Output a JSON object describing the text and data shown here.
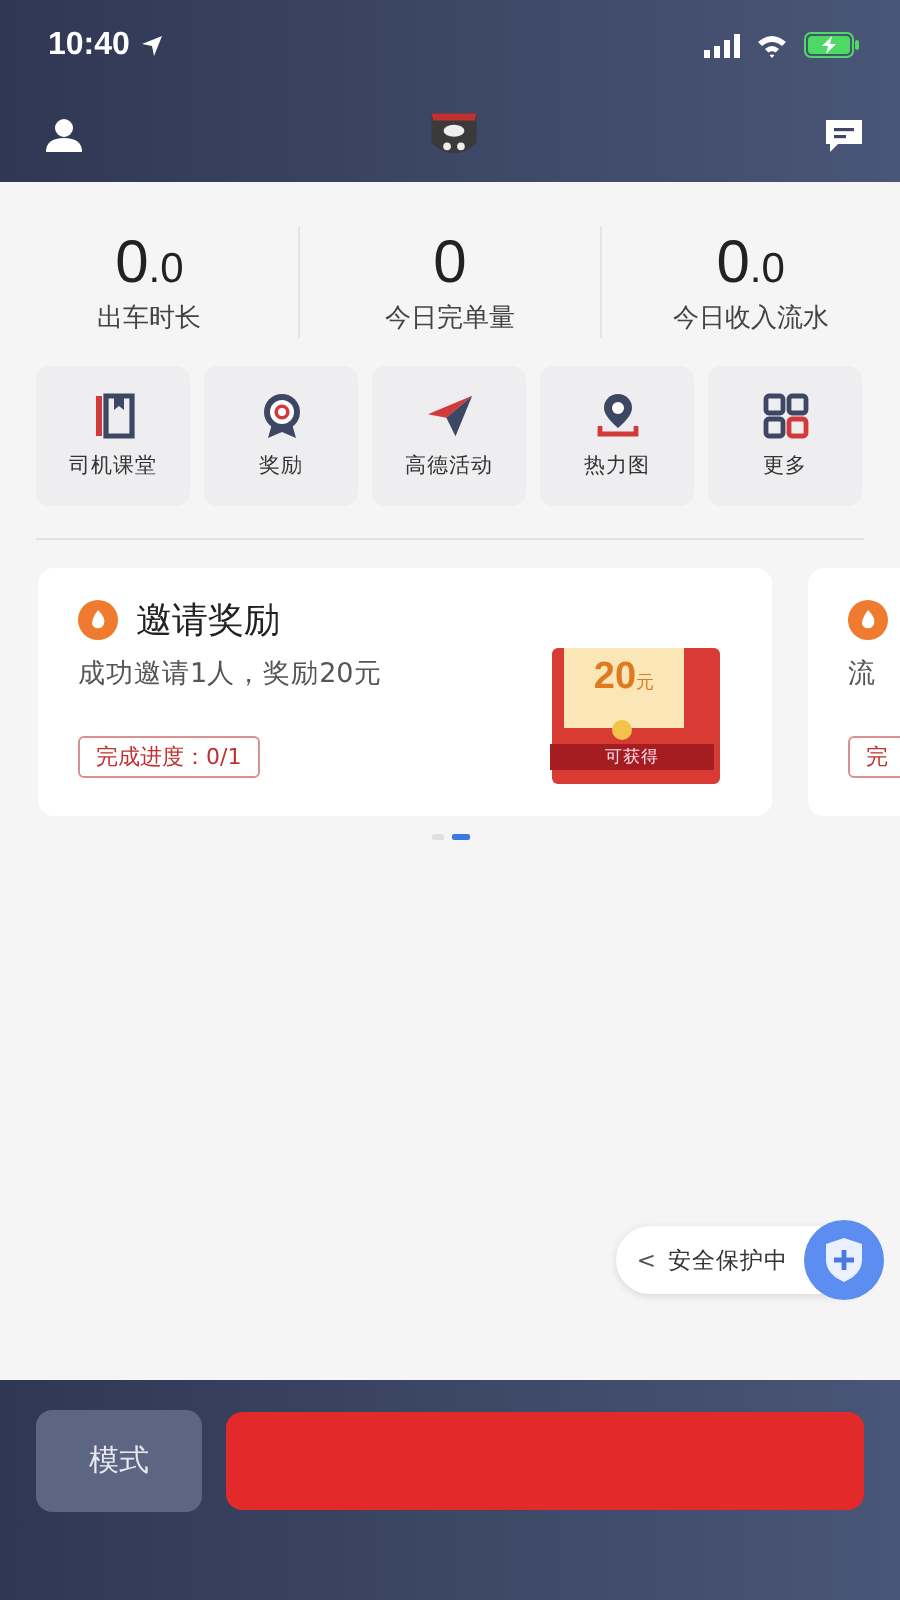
{
  "status_bar": {
    "time": "10:40"
  },
  "stats": [
    {
      "value": "0",
      "decimal": ".0",
      "label": "出车时长"
    },
    {
      "value": "0",
      "label": "今日完单量"
    },
    {
      "value": "0",
      "decimal": ".0",
      "label": "今日收入流水"
    }
  ],
  "shortcuts": [
    {
      "kind": "book",
      "label": "司机课堂"
    },
    {
      "kind": "medal",
      "label": "奖励"
    },
    {
      "kind": "plane",
      "label": "高德活动"
    },
    {
      "kind": "pin",
      "label": "热力图"
    },
    {
      "kind": "grid",
      "label": "更多"
    }
  ],
  "cards": [
    {
      "title": "邀请奖励",
      "subtitle": "成功邀请1人，奖励20元",
      "progress": "完成进度：0/1",
      "reward": {
        "amount": "20",
        "unit": "元",
        "caption": "可获得"
      }
    },
    {
      "subtitle": "流",
      "progress": "完"
    }
  ],
  "page_dots": [
    {
      "selected": false
    },
    {
      "selected": true
    }
  ],
  "safety_pill": {
    "arrow": "<",
    "label": "安全保护中"
  },
  "bottom_bar": {
    "mode_button": "模式"
  }
}
